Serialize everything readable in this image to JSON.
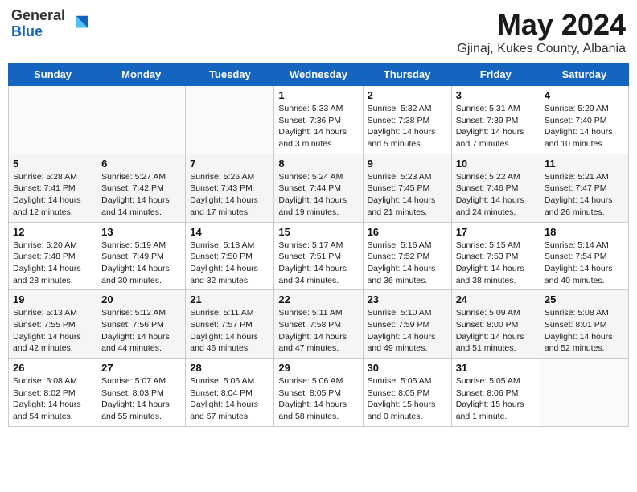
{
  "logo": {
    "general": "General",
    "blue": "Blue"
  },
  "title": "May 2024",
  "subtitle": "Gjinaj, Kukes County, Albania",
  "days_of_week": [
    "Sunday",
    "Monday",
    "Tuesday",
    "Wednesday",
    "Thursday",
    "Friday",
    "Saturday"
  ],
  "weeks": [
    [
      {
        "day": "",
        "info": ""
      },
      {
        "day": "",
        "info": ""
      },
      {
        "day": "",
        "info": ""
      },
      {
        "day": "1",
        "info": "Sunrise: 5:33 AM\nSunset: 7:36 PM\nDaylight: 14 hours\nand 3 minutes."
      },
      {
        "day": "2",
        "info": "Sunrise: 5:32 AM\nSunset: 7:38 PM\nDaylight: 14 hours\nand 5 minutes."
      },
      {
        "day": "3",
        "info": "Sunrise: 5:31 AM\nSunset: 7:39 PM\nDaylight: 14 hours\nand 7 minutes."
      },
      {
        "day": "4",
        "info": "Sunrise: 5:29 AM\nSunset: 7:40 PM\nDaylight: 14 hours\nand 10 minutes."
      }
    ],
    [
      {
        "day": "5",
        "info": "Sunrise: 5:28 AM\nSunset: 7:41 PM\nDaylight: 14 hours\nand 12 minutes."
      },
      {
        "day": "6",
        "info": "Sunrise: 5:27 AM\nSunset: 7:42 PM\nDaylight: 14 hours\nand 14 minutes."
      },
      {
        "day": "7",
        "info": "Sunrise: 5:26 AM\nSunset: 7:43 PM\nDaylight: 14 hours\nand 17 minutes."
      },
      {
        "day": "8",
        "info": "Sunrise: 5:24 AM\nSunset: 7:44 PM\nDaylight: 14 hours\nand 19 minutes."
      },
      {
        "day": "9",
        "info": "Sunrise: 5:23 AM\nSunset: 7:45 PM\nDaylight: 14 hours\nand 21 minutes."
      },
      {
        "day": "10",
        "info": "Sunrise: 5:22 AM\nSunset: 7:46 PM\nDaylight: 14 hours\nand 24 minutes."
      },
      {
        "day": "11",
        "info": "Sunrise: 5:21 AM\nSunset: 7:47 PM\nDaylight: 14 hours\nand 26 minutes."
      }
    ],
    [
      {
        "day": "12",
        "info": "Sunrise: 5:20 AM\nSunset: 7:48 PM\nDaylight: 14 hours\nand 28 minutes."
      },
      {
        "day": "13",
        "info": "Sunrise: 5:19 AM\nSunset: 7:49 PM\nDaylight: 14 hours\nand 30 minutes."
      },
      {
        "day": "14",
        "info": "Sunrise: 5:18 AM\nSunset: 7:50 PM\nDaylight: 14 hours\nand 32 minutes."
      },
      {
        "day": "15",
        "info": "Sunrise: 5:17 AM\nSunset: 7:51 PM\nDaylight: 14 hours\nand 34 minutes."
      },
      {
        "day": "16",
        "info": "Sunrise: 5:16 AM\nSunset: 7:52 PM\nDaylight: 14 hours\nand 36 minutes."
      },
      {
        "day": "17",
        "info": "Sunrise: 5:15 AM\nSunset: 7:53 PM\nDaylight: 14 hours\nand 38 minutes."
      },
      {
        "day": "18",
        "info": "Sunrise: 5:14 AM\nSunset: 7:54 PM\nDaylight: 14 hours\nand 40 minutes."
      }
    ],
    [
      {
        "day": "19",
        "info": "Sunrise: 5:13 AM\nSunset: 7:55 PM\nDaylight: 14 hours\nand 42 minutes."
      },
      {
        "day": "20",
        "info": "Sunrise: 5:12 AM\nSunset: 7:56 PM\nDaylight: 14 hours\nand 44 minutes."
      },
      {
        "day": "21",
        "info": "Sunrise: 5:11 AM\nSunset: 7:57 PM\nDaylight: 14 hours\nand 46 minutes."
      },
      {
        "day": "22",
        "info": "Sunrise: 5:11 AM\nSunset: 7:58 PM\nDaylight: 14 hours\nand 47 minutes."
      },
      {
        "day": "23",
        "info": "Sunrise: 5:10 AM\nSunset: 7:59 PM\nDaylight: 14 hours\nand 49 minutes."
      },
      {
        "day": "24",
        "info": "Sunrise: 5:09 AM\nSunset: 8:00 PM\nDaylight: 14 hours\nand 51 minutes."
      },
      {
        "day": "25",
        "info": "Sunrise: 5:08 AM\nSunset: 8:01 PM\nDaylight: 14 hours\nand 52 minutes."
      }
    ],
    [
      {
        "day": "26",
        "info": "Sunrise: 5:08 AM\nSunset: 8:02 PM\nDaylight: 14 hours\nand 54 minutes."
      },
      {
        "day": "27",
        "info": "Sunrise: 5:07 AM\nSunset: 8:03 PM\nDaylight: 14 hours\nand 55 minutes."
      },
      {
        "day": "28",
        "info": "Sunrise: 5:06 AM\nSunset: 8:04 PM\nDaylight: 14 hours\nand 57 minutes."
      },
      {
        "day": "29",
        "info": "Sunrise: 5:06 AM\nSunset: 8:05 PM\nDaylight: 14 hours\nand 58 minutes."
      },
      {
        "day": "30",
        "info": "Sunrise: 5:05 AM\nSunset: 8:05 PM\nDaylight: 15 hours\nand 0 minutes."
      },
      {
        "day": "31",
        "info": "Sunrise: 5:05 AM\nSunset: 8:06 PM\nDaylight: 15 hours\nand 1 minute."
      },
      {
        "day": "",
        "info": ""
      }
    ]
  ]
}
